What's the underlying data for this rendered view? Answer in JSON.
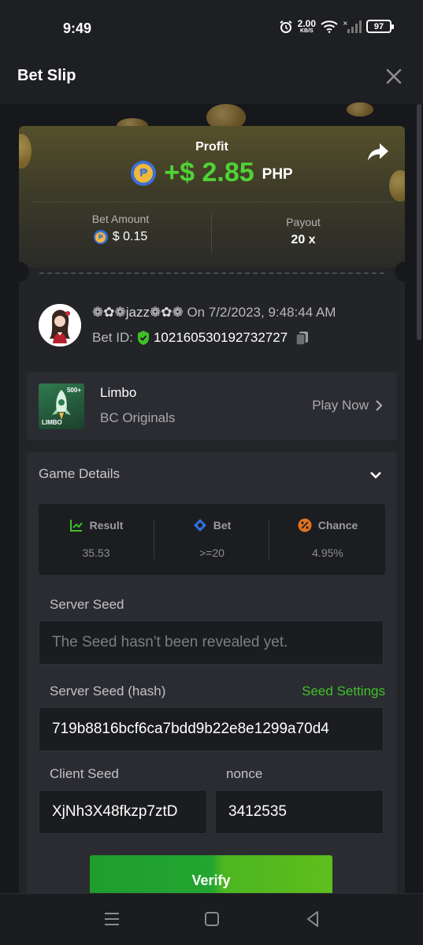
{
  "status_bar": {
    "time": "9:49",
    "net_speed": "2.00",
    "net_unit": "KB/S",
    "battery": "97"
  },
  "header": {
    "title": "Bet Slip"
  },
  "hero": {
    "profit_label": "Profit",
    "profit_amount": "+$ 2.85",
    "profit_currency": "PHP",
    "coin_symbol": "₱",
    "bet_amount_label": "Bet Amount",
    "bet_amount_value": "$ 0.15",
    "payout_label": "Payout",
    "payout_value": "20 x"
  },
  "bet_info": {
    "username": "❁✿❁jazz❁✿❁",
    "on_text": "On 7/2/2023, 9:48:44 AM",
    "bet_id_label": "Bet ID:",
    "bet_id_value": "102160530192732727"
  },
  "game": {
    "name": "Limbo",
    "category": "BC Originals",
    "play_label": "Play Now",
    "thumb_text": "LIMBO",
    "thumb_badge": "500+"
  },
  "details": {
    "title": "Game Details",
    "stats": [
      {
        "label": "Result",
        "value": "35.53"
      },
      {
        "label": "Bet",
        "value": ">=20"
      },
      {
        "label": "Chance",
        "value": "4.95%"
      }
    ],
    "server_seed_label": "Server Seed",
    "server_seed_value": "The Seed hasn't been revealed yet.",
    "server_hash_label": "Server Seed (hash)",
    "seed_settings_label": "Seed Settings",
    "server_hash_value": "719b8816bcf6ca7bdd9b22e8e1299a70d4",
    "client_seed_label": "Client Seed",
    "client_seed_value": "XjNh3X48fkzp7ztD",
    "nonce_label": "nonce",
    "nonce_value": "3412535",
    "verify_label": "Verify"
  },
  "colors": {
    "accent_green": "#4fd335",
    "link_green": "#3fbf2a",
    "background": "#17181b",
    "card": "#232428"
  }
}
